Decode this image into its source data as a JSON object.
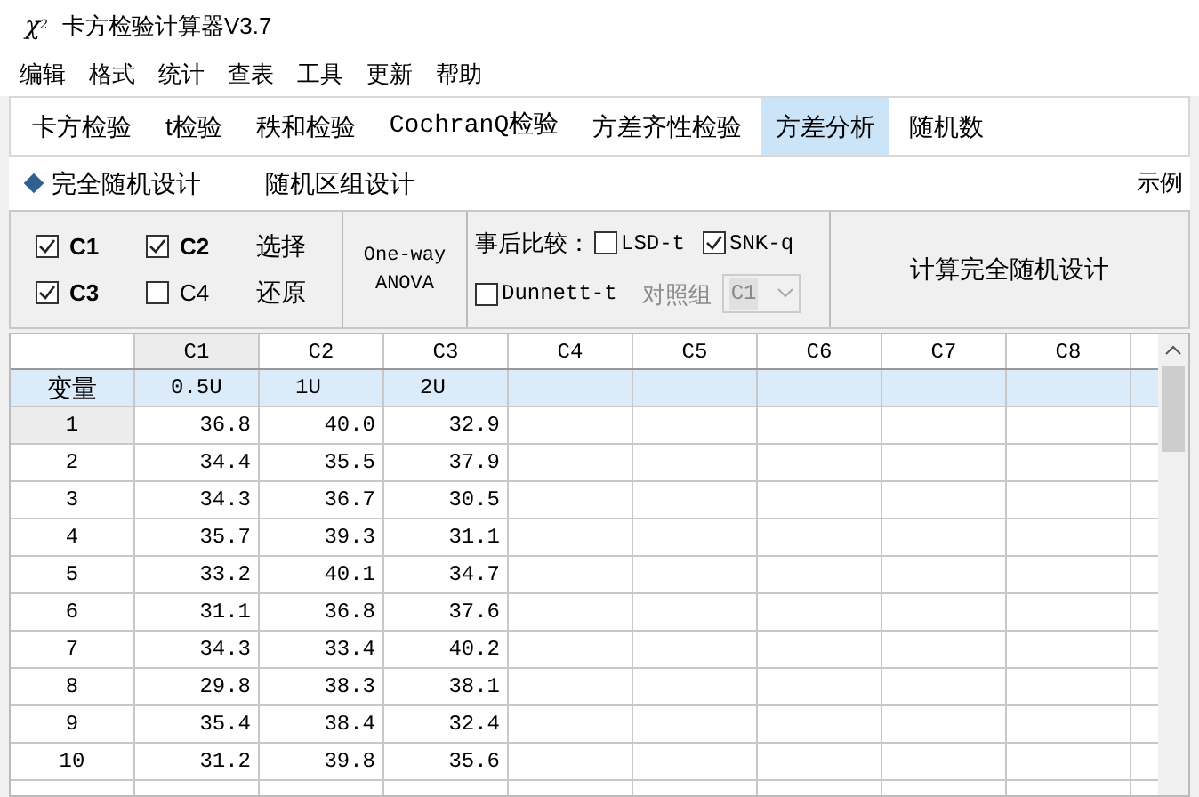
{
  "window": {
    "logo": {
      "symbol": "χ",
      "superscript": "2"
    },
    "title": "卡方检验计算器V3.7"
  },
  "menu": [
    "编辑",
    "格式",
    "统计",
    "查表",
    "工具",
    "更新",
    "帮助"
  ],
  "tabs": [
    {
      "label": "卡方检验",
      "selected": false
    },
    {
      "label": "t检验",
      "selected": false
    },
    {
      "label": "秩和检验",
      "selected": false
    },
    {
      "label": "CochranQ检验",
      "selected": false
    },
    {
      "label": "方差齐性检验",
      "selected": false
    },
    {
      "label": "方差分析",
      "selected": true
    },
    {
      "label": "随机数",
      "selected": false
    }
  ],
  "designs": [
    {
      "label": "完全随机设计",
      "selected": true
    },
    {
      "label": "随机区组设计",
      "selected": false
    }
  ],
  "example_link": "示例",
  "column_checks": [
    {
      "label": "C1",
      "checked": true
    },
    {
      "label": "C2",
      "checked": true
    },
    {
      "label": "C3",
      "checked": true
    },
    {
      "label": "C4",
      "checked": false
    }
  ],
  "select_buttons": [
    "选择",
    "还原"
  ],
  "anova_label": [
    "One-way",
    "ANOVA"
  ],
  "post_hoc": {
    "label": "事后比较：",
    "options": [
      {
        "label": "LSD-t",
        "checked": false
      },
      {
        "label": "SNK-q",
        "checked": true
      },
      {
        "label": "Dunnett-t",
        "checked": false
      }
    ],
    "control_label": "对照组",
    "control_value": "C1",
    "control_disabled": true
  },
  "compute_button": "计算完全随机设计",
  "grid": {
    "columns": [
      {
        "label": "C1",
        "selected": true
      },
      {
        "label": "C2",
        "selected": false
      },
      {
        "label": "C3",
        "selected": false
      },
      {
        "label": "C4",
        "selected": false
      },
      {
        "label": "C5",
        "selected": false
      },
      {
        "label": "C6",
        "selected": false
      },
      {
        "label": "C7",
        "selected": false
      },
      {
        "label": "C8",
        "selected": false
      }
    ],
    "variable_row": {
      "label": "变量",
      "values": [
        "0.5U",
        "1U",
        "2U"
      ]
    },
    "rows": [
      {
        "label": "1",
        "selected": true,
        "values": [
          "36.8",
          "40.0",
          "32.9"
        ]
      },
      {
        "label": "2",
        "selected": false,
        "values": [
          "34.4",
          "35.5",
          "37.9"
        ]
      },
      {
        "label": "3",
        "selected": false,
        "values": [
          "34.3",
          "36.7",
          "30.5"
        ]
      },
      {
        "label": "4",
        "selected": false,
        "values": [
          "35.7",
          "39.3",
          "31.1"
        ]
      },
      {
        "label": "5",
        "selected": false,
        "values": [
          "33.2",
          "40.1",
          "34.7"
        ]
      },
      {
        "label": "6",
        "selected": false,
        "values": [
          "31.1",
          "36.8",
          "37.6"
        ]
      },
      {
        "label": "7",
        "selected": false,
        "values": [
          "34.3",
          "33.4",
          "40.2"
        ]
      },
      {
        "label": "8",
        "selected": false,
        "values": [
          "29.8",
          "38.3",
          "38.1"
        ]
      },
      {
        "label": "9",
        "selected": false,
        "values": [
          "35.4",
          "38.4",
          "32.4"
        ]
      },
      {
        "label": "10",
        "selected": false,
        "values": [
          "31.2",
          "39.8",
          "35.6"
        ]
      }
    ]
  }
}
